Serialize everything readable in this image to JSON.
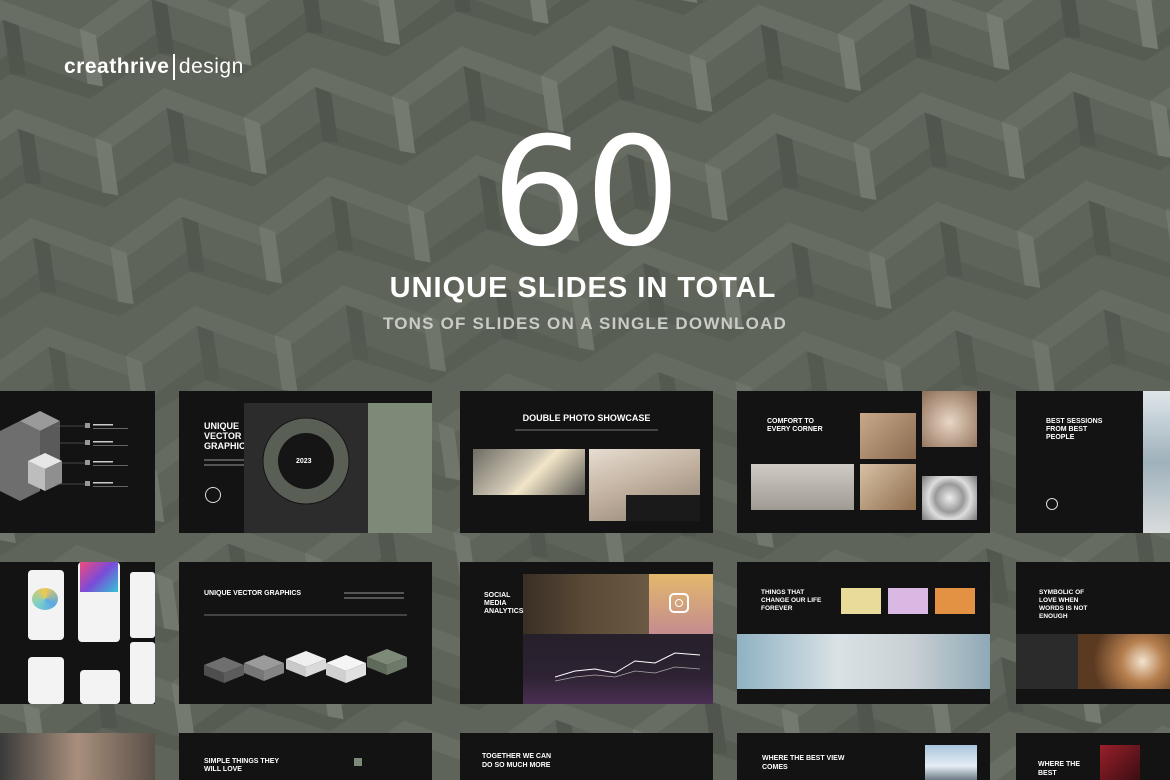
{
  "brand": {
    "name_bold": "creathrive",
    "name_light": "design"
  },
  "hero": {
    "number": "60",
    "title": "UNIQUE SLIDES IN TOTAL",
    "subtitle": "TONS OF SLIDES ON A SINGLE DOWNLOAD"
  },
  "slides": {
    "s2_title": "UNIQUE VECTOR GRAPHICS",
    "s2_year": "2023",
    "s3_title": "DOUBLE PHOTO SHOWCASE",
    "s4_title": "COMFORT TO EVERY CORNER",
    "s5_title": "BEST SESSIONS FROM BEST PEOPLE",
    "s7_title": "UNIQUE VECTOR GRAPHICS",
    "s8_title": "SOCIAL MEDIA ANALYTICS",
    "s9_title": "THINGS THAT CHANGE OUR LIFE FOREVER",
    "s10_title": "SYMBOLIC OF LOVE WHEN WORDS IS NOT ENOUGH",
    "s12_title": "SIMPLE THINGS THEY WILL LOVE",
    "s13_title": "TOGETHER WE CAN DO SO MUCH MORE",
    "s14_title": "WHERE THE BEST VIEW COMES",
    "s15_title": "WHERE THE BEST"
  },
  "colors": {
    "background": "#5d6358",
    "slide_bg": "#131313",
    "accent_sage": "#7d8a78"
  },
  "icons": [
    "instagram-icon"
  ]
}
